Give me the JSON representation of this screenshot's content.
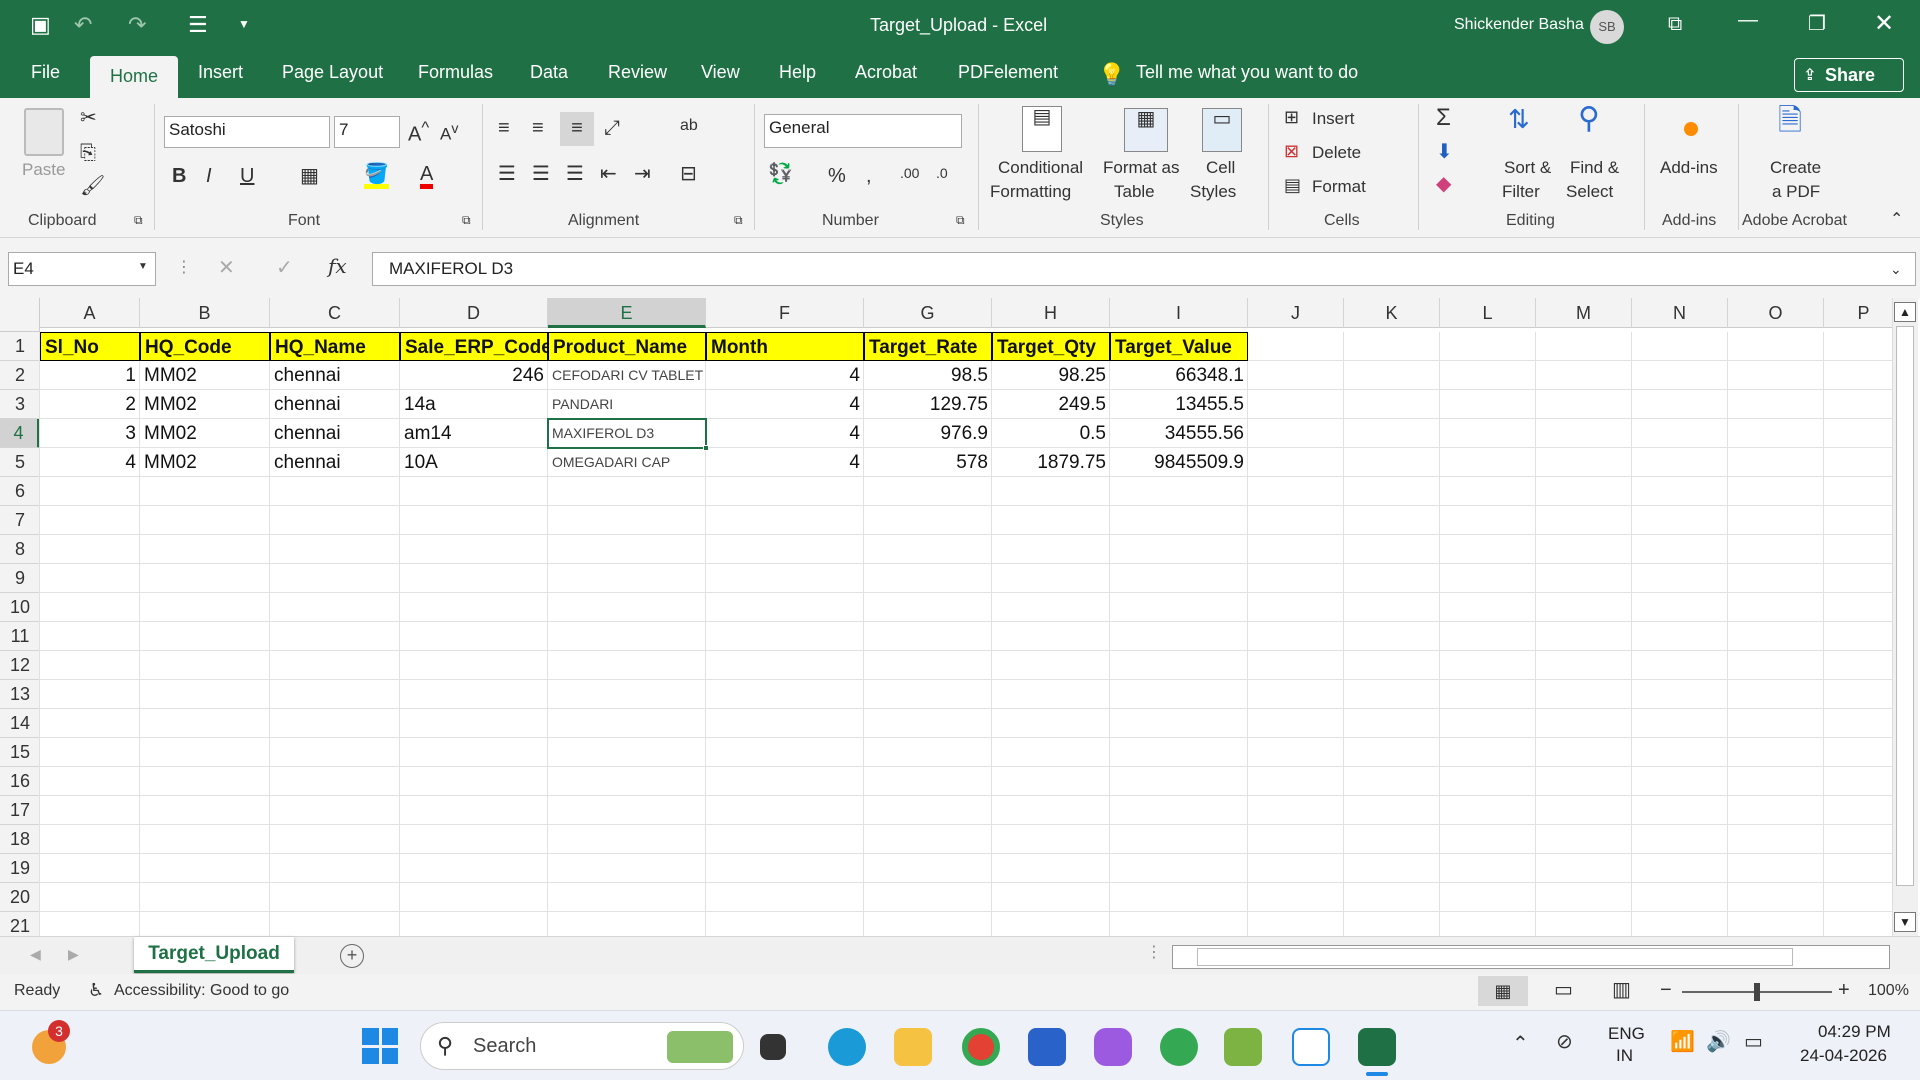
{
  "app": {
    "title": "Target_Upload - Excel",
    "user_name": "Shickender Basha",
    "user_initials": "SB",
    "share_label": "Share"
  },
  "tabs": [
    "File",
    "Home",
    "Insert",
    "Page Layout",
    "Formulas",
    "Data",
    "Review",
    "View",
    "Help",
    "Acrobat",
    "PDFelement"
  ],
  "tell_me": "Tell me what you want to do",
  "ribbon": {
    "paste": "Paste",
    "font_name": "Satoshi",
    "font_size": "7",
    "number_format": "General",
    "conditional_formatting": [
      "Conditional",
      "Formatting"
    ],
    "format_as_table": [
      "Format as",
      "Table"
    ],
    "cell_styles": [
      "Cell",
      "Styles"
    ],
    "insert": "Insert",
    "delete": "Delete",
    "format": "Format",
    "sort_filter": [
      "Sort &",
      "Filter"
    ],
    "find_select": [
      "Find &",
      "Select"
    ],
    "addins": "Add-ins",
    "create_pdf": [
      "Create",
      "a PDF"
    ],
    "groups": [
      "Clipboard",
      "Font",
      "Alignment",
      "Number",
      "Styles",
      "Cells",
      "Editing",
      "Add-ins",
      "Adobe Acrobat"
    ]
  },
  "formula_bar": {
    "name_box": "E4",
    "fx": "fx",
    "content": "MAXIFEROL D3"
  },
  "columns": [
    "A",
    "B",
    "C",
    "D",
    "E",
    "F",
    "G",
    "H",
    "I",
    "J",
    "K",
    "L",
    "M",
    "N",
    "O",
    "P"
  ],
  "row_numbers": [
    "1",
    "2",
    "3",
    "4",
    "5",
    "6",
    "7",
    "8",
    "9",
    "10",
    "11",
    "12",
    "13",
    "14",
    "15",
    "16",
    "17",
    "18",
    "19",
    "20",
    "21"
  ],
  "header_row": [
    "Sl_No",
    "HQ_Code",
    "HQ_Name",
    "Sale_ERP_Code",
    "Product_Name",
    "Month",
    "Target_Rate",
    "Target_Qty",
    "Target_Value"
  ],
  "rows": [
    [
      "1",
      "MM02",
      "chennai",
      "246",
      "CEFODARI CV TABLET",
      "4",
      "98.5",
      "98.25",
      "66348.1"
    ],
    [
      "2",
      "MM02",
      "chennai",
      "14a",
      "PANDARI",
      "4",
      "129.75",
      "249.5",
      "13455.5"
    ],
    [
      "3",
      "MM02",
      "chennai",
      "am14",
      "MAXIFEROL D3",
      "4",
      "976.9",
      "0.5",
      "34555.56"
    ],
    [
      "4",
      "MM02",
      "chennai",
      "10A",
      "OMEGADARI CAP",
      "4",
      "578",
      "1879.75",
      "9845509.9"
    ]
  ],
  "sheet_tab": "Target_Upload",
  "status": {
    "ready": "Ready",
    "accessibility": "Accessibility: Good to go",
    "zoom": "100%"
  },
  "taskbar": {
    "search": "Search",
    "badge": "3",
    "lang": [
      "ENG",
      "IN"
    ],
    "time": "04:29 PM",
    "date": "24-04-2026"
  },
  "colors": {
    "excel_green": "#1f7145",
    "header_fill": "#ffff00",
    "selection": "#1e7145"
  }
}
